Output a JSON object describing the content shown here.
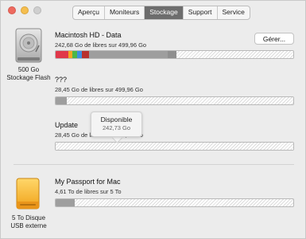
{
  "window": {
    "tabs": [
      "Aperçu",
      "Moniteurs",
      "Stockage",
      "Support",
      "Service"
    ],
    "active_tab": "Stockage"
  },
  "internal_disk": {
    "caption_line1": "500 Go",
    "caption_line2": "Stockage Flash",
    "volumes": [
      {
        "name": "Macintosh HD - Data",
        "subtitle": "242,68 Go de libres sur 499,96 Go",
        "action_label": "Gérer...",
        "usage_colors": [
          "#e0384a",
          "#f5a623",
          "#4cb748",
          "#3d8fe0",
          "#b8322e",
          "#9e9e9e",
          "#8f8f8f"
        ],
        "used_fraction": 0.51
      },
      {
        "name": "???",
        "subtitle": "28,45 Go de libres sur 499,96 Go",
        "usage_colors": [
          "#9e9e9e"
        ],
        "used_fraction": 0.05
      },
      {
        "name": "Update",
        "subtitle": "28,45 Go de libres sur 499,96 Go",
        "usage_colors": [],
        "used_fraction": 0.0
      }
    ],
    "tooltip": {
      "title": "Disponible",
      "value": "242,73 Go"
    }
  },
  "external_disk": {
    "caption_line1": "5 To Disque",
    "caption_line2": "USB externe",
    "volume": {
      "name": "My Passport for Mac",
      "subtitle": "4,61 To de libres sur 5 To",
      "usage_colors": [
        "#9e9e9e"
      ],
      "used_fraction": 0.08
    }
  }
}
